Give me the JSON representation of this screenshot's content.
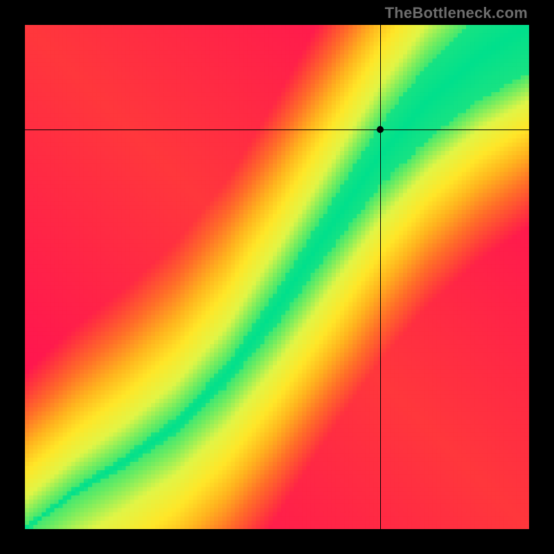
{
  "watermark": "TheBottleneck.com",
  "chart_data": {
    "type": "heatmap",
    "title": "",
    "xlabel": "",
    "ylabel": "",
    "xlim": [
      0,
      1
    ],
    "ylim": [
      0,
      1
    ],
    "grid_size": 120,
    "marker": {
      "x": 0.705,
      "y": 0.792
    },
    "crosshair": {
      "x": 0.705,
      "y": 0.792
    },
    "ridge": {
      "description": "Monotone ridge y=f(x) where colour is greenest (minimum score). Piecewise-linear through control points.",
      "points": [
        [
          0.0,
          0.0
        ],
        [
          0.1,
          0.075
        ],
        [
          0.2,
          0.135
        ],
        [
          0.3,
          0.205
        ],
        [
          0.4,
          0.305
        ],
        [
          0.5,
          0.44
        ],
        [
          0.6,
          0.59
        ],
        [
          0.7,
          0.735
        ],
        [
          0.8,
          0.85
        ],
        [
          0.9,
          0.935
        ],
        [
          1.0,
          1.0
        ]
      ]
    },
    "ridge_half_width": {
      "description": "Approximate half-width of the green band (in y units) as a function of x.",
      "points": [
        [
          0.0,
          0.005
        ],
        [
          0.2,
          0.012
        ],
        [
          0.4,
          0.022
        ],
        [
          0.6,
          0.045
        ],
        [
          0.8,
          0.075
        ],
        [
          1.0,
          0.095
        ]
      ]
    },
    "colour_stops": [
      {
        "t": 0.0,
        "rgb": [
          0,
          224,
          140
        ]
      },
      {
        "t": 0.12,
        "rgb": [
          100,
          235,
          100
        ]
      },
      {
        "t": 0.25,
        "rgb": [
          225,
          245,
          70
        ]
      },
      {
        "t": 0.4,
        "rgb": [
          255,
          230,
          40
        ]
      },
      {
        "t": 0.55,
        "rgb": [
          255,
          180,
          30
        ]
      },
      {
        "t": 0.72,
        "rgb": [
          255,
          110,
          40
        ]
      },
      {
        "t": 0.88,
        "rgb": [
          255,
          55,
          60
        ]
      },
      {
        "t": 1.0,
        "rgb": [
          255,
          20,
          80
        ]
      }
    ]
  }
}
